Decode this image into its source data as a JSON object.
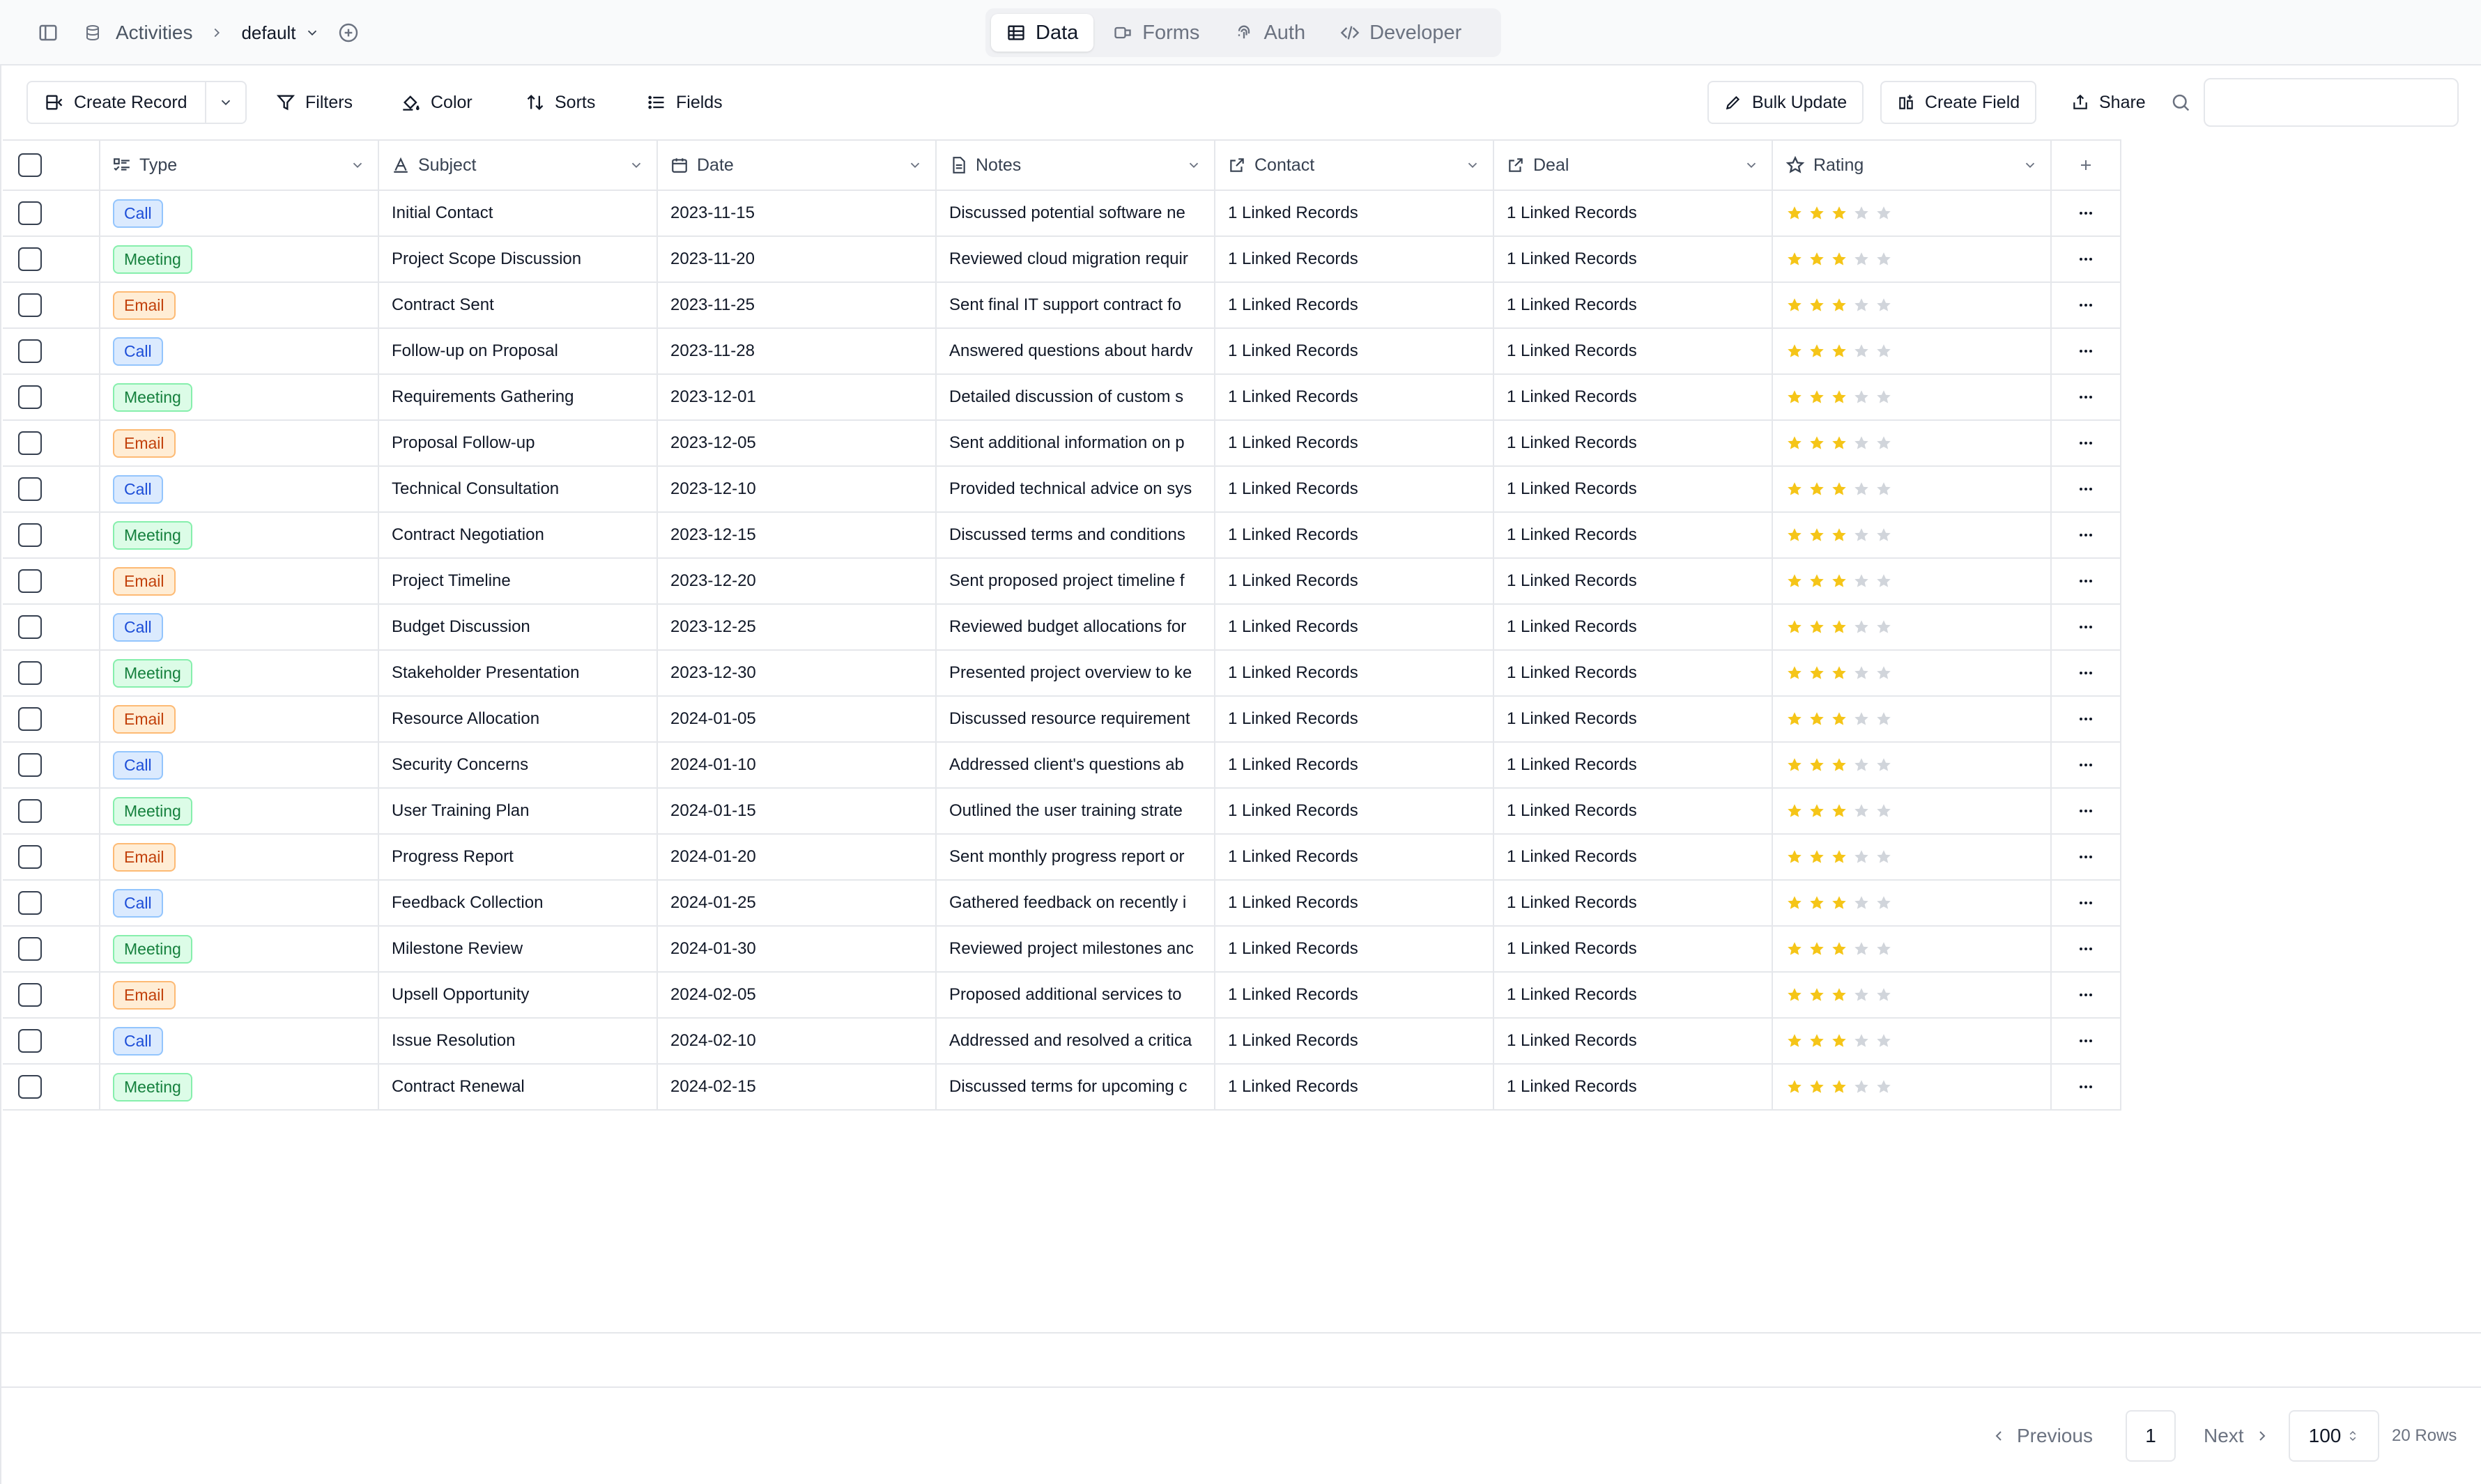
{
  "topbar": {
    "breadcrumb_table": "Activities",
    "breadcrumb_view": "default",
    "tabs": [
      {
        "label": "Data",
        "icon": "table-icon",
        "active": true
      },
      {
        "label": "Forms",
        "icon": "forms-icon",
        "active": false
      },
      {
        "label": "Auth",
        "icon": "fingerprint-icon",
        "active": false
      },
      {
        "label": "Developer",
        "icon": "code-icon",
        "active": false
      }
    ]
  },
  "toolbar": {
    "create_record": "Create Record",
    "filters": "Filters",
    "color": "Color",
    "sorts": "Sorts",
    "fields": "Fields",
    "bulk_update": "Bulk Update",
    "create_field": "Create Field",
    "share": "Share",
    "search_value": ""
  },
  "columns": {
    "type": "Type",
    "subject": "Subject",
    "date": "Date",
    "notes": "Notes",
    "contact": "Contact",
    "deal": "Deal",
    "rating": "Rating"
  },
  "rows": [
    {
      "type": "Call",
      "subject": "Initial Contact",
      "date": "2023-11-15",
      "notes": "Discussed potential software ne",
      "contact": "1 Linked Records",
      "deal": "1 Linked Records",
      "rating": 3
    },
    {
      "type": "Meeting",
      "subject": "Project Scope Discussion",
      "date": "2023-11-20",
      "notes": "Reviewed cloud migration requir",
      "contact": "1 Linked Records",
      "deal": "1 Linked Records",
      "rating": 3
    },
    {
      "type": "Email",
      "subject": "Contract Sent",
      "date": "2023-11-25",
      "notes": "Sent final IT support contract fo",
      "contact": "1 Linked Records",
      "deal": "1 Linked Records",
      "rating": 3
    },
    {
      "type": "Call",
      "subject": "Follow-up on Proposal",
      "date": "2023-11-28",
      "notes": "Answered questions about hardv",
      "contact": "1 Linked Records",
      "deal": "1 Linked Records",
      "rating": 3
    },
    {
      "type": "Meeting",
      "subject": "Requirements Gathering",
      "date": "2023-12-01",
      "notes": "Detailed discussion of custom s",
      "contact": "1 Linked Records",
      "deal": "1 Linked Records",
      "rating": 3
    },
    {
      "type": "Email",
      "subject": "Proposal Follow-up",
      "date": "2023-12-05",
      "notes": "Sent additional information on p",
      "contact": "1 Linked Records",
      "deal": "1 Linked Records",
      "rating": 3
    },
    {
      "type": "Call",
      "subject": "Technical Consultation",
      "date": "2023-12-10",
      "notes": "Provided technical advice on sys",
      "contact": "1 Linked Records",
      "deal": "1 Linked Records",
      "rating": 3
    },
    {
      "type": "Meeting",
      "subject": "Contract Negotiation",
      "date": "2023-12-15",
      "notes": "Discussed terms and conditions",
      "contact": "1 Linked Records",
      "deal": "1 Linked Records",
      "rating": 3
    },
    {
      "type": "Email",
      "subject": "Project Timeline",
      "date": "2023-12-20",
      "notes": "Sent proposed project timeline f",
      "contact": "1 Linked Records",
      "deal": "1 Linked Records",
      "rating": 3
    },
    {
      "type": "Call",
      "subject": "Budget Discussion",
      "date": "2023-12-25",
      "notes": "Reviewed budget allocations for",
      "contact": "1 Linked Records",
      "deal": "1 Linked Records",
      "rating": 3
    },
    {
      "type": "Meeting",
      "subject": "Stakeholder Presentation",
      "date": "2023-12-30",
      "notes": "Presented project overview to ke",
      "contact": "1 Linked Records",
      "deal": "1 Linked Records",
      "rating": 3
    },
    {
      "type": "Email",
      "subject": "Resource Allocation",
      "date": "2024-01-05",
      "notes": "Discussed resource requirement",
      "contact": "1 Linked Records",
      "deal": "1 Linked Records",
      "rating": 3
    },
    {
      "type": "Call",
      "subject": "Security Concerns",
      "date": "2024-01-10",
      "notes": "Addressed client's questions ab",
      "contact": "1 Linked Records",
      "deal": "1 Linked Records",
      "rating": 3
    },
    {
      "type": "Meeting",
      "subject": "User Training Plan",
      "date": "2024-01-15",
      "notes": "Outlined the user training strate",
      "contact": "1 Linked Records",
      "deal": "1 Linked Records",
      "rating": 3
    },
    {
      "type": "Email",
      "subject": "Progress Report",
      "date": "2024-01-20",
      "notes": "Sent monthly progress report or",
      "contact": "1 Linked Records",
      "deal": "1 Linked Records",
      "rating": 3
    },
    {
      "type": "Call",
      "subject": "Feedback Collection",
      "date": "2024-01-25",
      "notes": "Gathered feedback on recently i",
      "contact": "1 Linked Records",
      "deal": "1 Linked Records",
      "rating": 3
    },
    {
      "type": "Meeting",
      "subject": "Milestone Review",
      "date": "2024-01-30",
      "notes": "Reviewed project milestones anc",
      "contact": "1 Linked Records",
      "deal": "1 Linked Records",
      "rating": 3
    },
    {
      "type": "Email",
      "subject": "Upsell Opportunity",
      "date": "2024-02-05",
      "notes": "Proposed additional services to",
      "contact": "1 Linked Records",
      "deal": "1 Linked Records",
      "rating": 3
    },
    {
      "type": "Call",
      "subject": "Issue Resolution",
      "date": "2024-02-10",
      "notes": "Addressed and resolved a critica",
      "contact": "1 Linked Records",
      "deal": "1 Linked Records",
      "rating": 3
    },
    {
      "type": "Meeting",
      "subject": "Contract Renewal",
      "date": "2024-02-15",
      "notes": "Discussed terms for upcoming c",
      "contact": "1 Linked Records",
      "deal": "1 Linked Records",
      "rating": 3
    }
  ],
  "rating_max": 5,
  "colors": {
    "star_filled": "#f5c518",
    "star_empty": "#d1d5db"
  },
  "footer": {
    "previous": "Previous",
    "page": "1",
    "next": "Next",
    "per_page": "100",
    "row_count": "20 Rows"
  }
}
